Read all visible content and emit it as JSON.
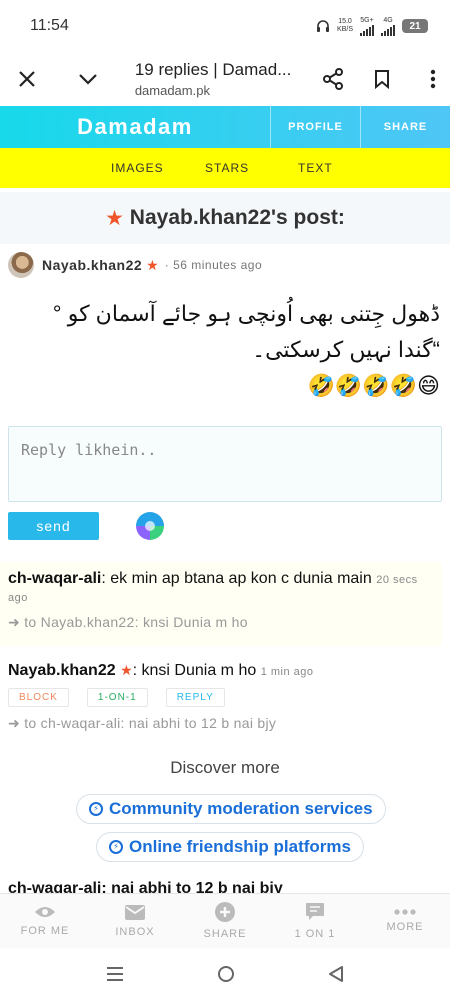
{
  "status_bar": {
    "time": "11:54",
    "net_speed": "15.0",
    "net_unit": "KB/S",
    "net_5g": "5G+",
    "net_4g": "4G",
    "battery": "21"
  },
  "browser": {
    "title": "19 replies | Damad...",
    "url": "damadam.pk"
  },
  "site_header": {
    "brand": "Damadam",
    "profile_label": "PROFILE",
    "share_label": "SHARE"
  },
  "nav": {
    "images": "IMAGES",
    "stars": "STARS",
    "text": "TEXT"
  },
  "post": {
    "heading": "Nayab.khan22's post:",
    "author": "Nayab.khan22",
    "time": "· 56 minutes ago",
    "line1": "ڈھول جِتنی بھی اُونچی ہو جائے آسمان کو °",
    "line2": "“گندا نہیں کرسکتی۔",
    "line3": "😄🤣🤣🤣🤣"
  },
  "reply_form": {
    "placeholder": "Reply likhein..",
    "send_label": "send"
  },
  "comments": [
    {
      "author": "ch-waqar-ali",
      "text": ": ek min ap btana ap kon c dunia main",
      "time": "20 secs ago",
      "reply_to": "➜ to Nayab.khan22: knsi Dunia m ho"
    },
    {
      "author": "Nayab.khan22",
      "text": ": knsi Dunia m ho",
      "time": "1 min ago",
      "reply_to": "➜ to ch-waqar-ali: nai abhi to 12 b nai bjy",
      "actions": {
        "block": "BLOCK",
        "one_on_one": "1-ON-1",
        "reply": "REPLY"
      }
    }
  ],
  "discover": {
    "title": "Discover more",
    "items": [
      "Community moderation services",
      "Online friendship platforms"
    ]
  },
  "cutoff_comment": "ch-waqar-ali: nai abhi to 12 b nai bjy",
  "tabs": [
    "FOR ME",
    "INBOX",
    "SHARE",
    "1 ON 1",
    "MORE"
  ],
  "colors": {
    "header_gradient_start": "#17d9ea",
    "header_gradient_end": "#4fc6f6",
    "nav_yellow": "#ffff00",
    "star": "#f0552b",
    "send_button": "#29b8ea",
    "block": "#f08a5d",
    "one_on_one": "#27ae60",
    "reply": "#29b8ea",
    "link_blue": "#1a6ed8"
  }
}
